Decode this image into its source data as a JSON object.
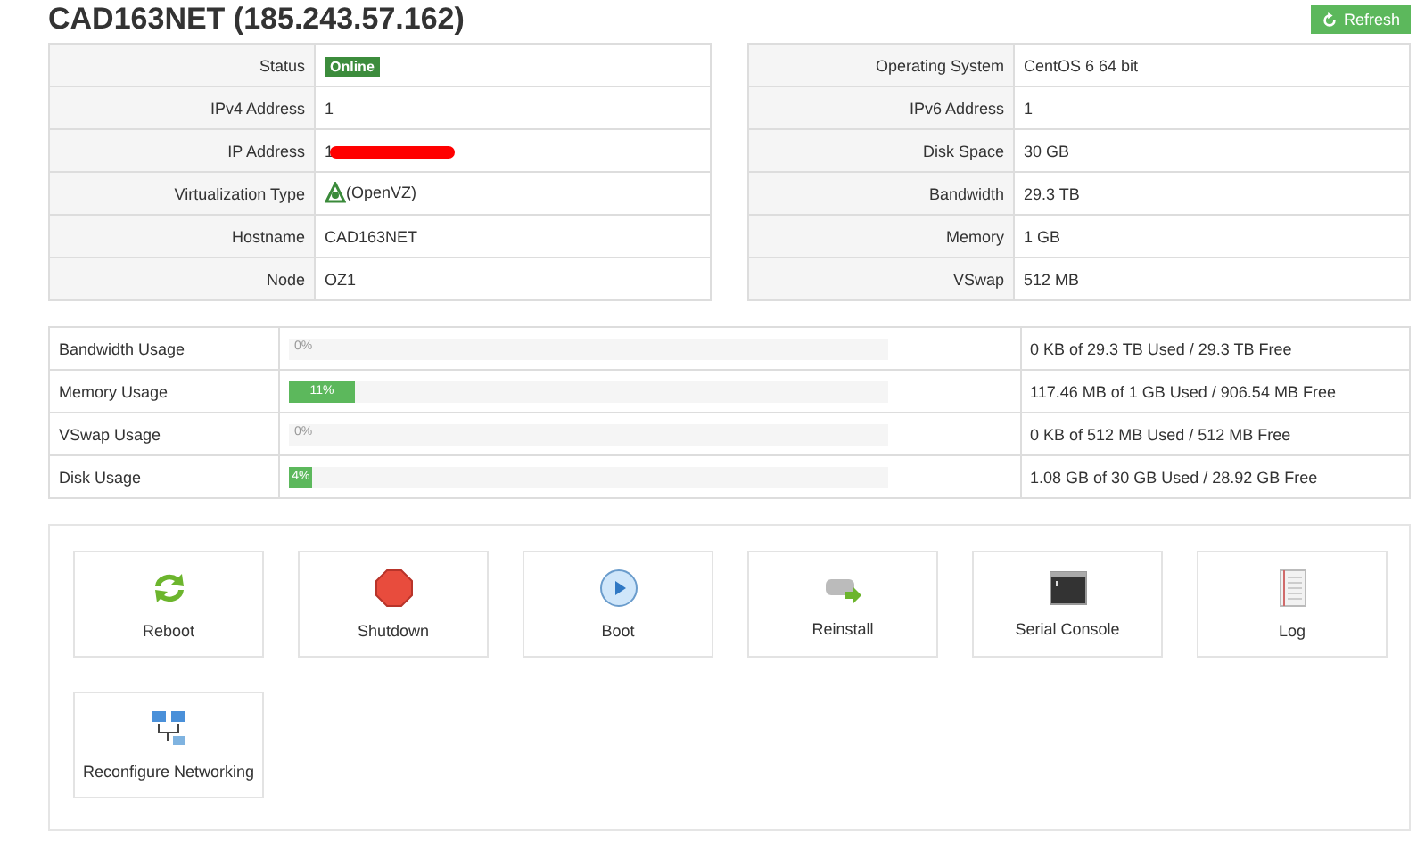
{
  "header": {
    "title": "CAD163NET (185.243.57.162)",
    "refresh_button": "Refresh"
  },
  "info_left": [
    {
      "label": "Status",
      "value": "Online",
      "kind": "badge"
    },
    {
      "label": "IPv4 Address",
      "value": "1",
      "kind": "text"
    },
    {
      "label": "IP Address",
      "value": "1",
      "kind": "redacted"
    },
    {
      "label": "Virtualization Type",
      "value": "(OpenVZ)",
      "kind": "icon"
    },
    {
      "label": "Hostname",
      "value": "CAD163NET",
      "kind": "text"
    },
    {
      "label": "Node",
      "value": "OZ1",
      "kind": "text"
    }
  ],
  "info_right": [
    {
      "label": "Operating System",
      "value": "CentOS 6 64 bit",
      "kind": "text"
    },
    {
      "label": "IPv6 Address",
      "value": "1",
      "kind": "text"
    },
    {
      "label": "Disk Space",
      "value": "30 GB",
      "kind": "text"
    },
    {
      "label": "Bandwidth",
      "value": "29.3 TB",
      "kind": "text"
    },
    {
      "label": "Memory",
      "value": "1 GB",
      "kind": "text"
    },
    {
      "label": "VSwap",
      "value": "512 MB",
      "kind": "text"
    }
  ],
  "usage": [
    {
      "name": "Bandwidth Usage",
      "level": 0,
      "percent": "0%",
      "detail": "0 KB of 29.3 TB Used / 29.3 TB Free"
    },
    {
      "name": "Memory Usage",
      "level": 0.11,
      "percent": "11%",
      "detail": "117.46 MB of 1 GB Used / 906.54 MB Free"
    },
    {
      "name": "VSwap Usage",
      "level": 0,
      "percent": "0%",
      "detail": "0 KB of 512 MB Used / 512 MB Free"
    },
    {
      "name": "Disk Usage",
      "level": 0.04,
      "percent": "4%",
      "detail": "1.08 GB of 30 GB Used / 28.92 GB Free"
    }
  ],
  "actions": [
    {
      "label": "Reboot",
      "kind": "reboot"
    },
    {
      "label": "Shutdown",
      "kind": "shutdown"
    },
    {
      "label": "Boot",
      "kind": "boot"
    },
    {
      "label": "Reinstall",
      "kind": "reinstall"
    },
    {
      "label": "Serial Console",
      "kind": "console"
    },
    {
      "label": "Log",
      "kind": "log"
    },
    {
      "label": "Reconfigure Networking",
      "kind": "network"
    }
  ]
}
